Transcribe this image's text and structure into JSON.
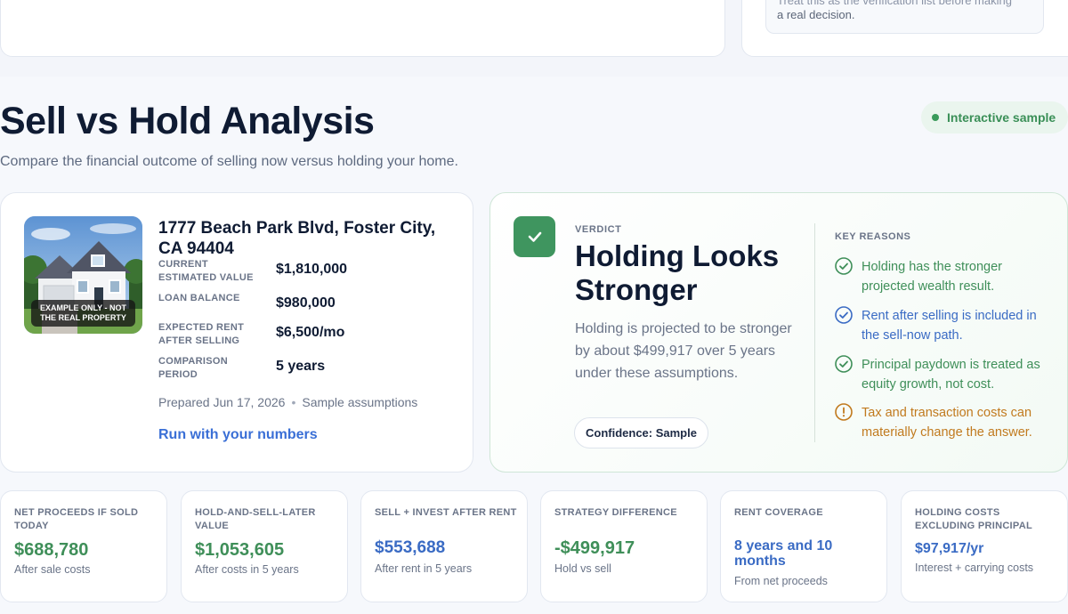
{
  "top_note": {
    "line1": "Treat this as the verification list before making",
    "line2": "a real decision."
  },
  "header": {
    "title": "Sell vs Hold Analysis",
    "subtitle": "Compare the financial outcome of selling now versus holding your home.",
    "badge": "Interactive sample"
  },
  "property": {
    "photo_caption": "EXAMPLE ONLY - NOT THE REAL PROPERTY",
    "address": "1777 Beach Park Blvd, Foster City, CA 94404",
    "rows": [
      {
        "label": "CURRENT ESTIMATED VALUE",
        "value": "$1,810,000"
      },
      {
        "label": "LOAN BALANCE",
        "value": "$980,000"
      },
      {
        "label": "EXPECTED RENT AFTER SELLING",
        "value": "$6,500/mo"
      },
      {
        "label": "COMPARISON PERIOD",
        "value": "5 years"
      }
    ],
    "prepared": "Prepared Jun 17, 2026",
    "assumptions": "Sample assumptions",
    "run_link": "Run with your numbers"
  },
  "verdict": {
    "label": "VERDICT",
    "title": "Holding Looks Stronger",
    "text": "Holding is projected to be stronger by about $499,917 over 5 years under these assumptions.",
    "confidence": "Confidence: Sample",
    "reasons_label": "KEY REASONS",
    "reasons": [
      {
        "text": "Holding has the stronger projected wealth result.",
        "tone": "green",
        "icon": "check-circle-icon"
      },
      {
        "text": "Rent after selling is included in the sell-now path.",
        "tone": "blue",
        "icon": "check-circle-icon"
      },
      {
        "text": "Principal paydown is treated as equity growth, not cost.",
        "tone": "green",
        "icon": "check-circle-icon"
      },
      {
        "text": "Tax and transaction costs can materially change the answer.",
        "tone": "amber",
        "icon": "alert-circle-icon"
      }
    ]
  },
  "stats": [
    {
      "label": "NET PROCEEDS IF SOLD TODAY",
      "value": "$688,780",
      "sub": "After sale costs",
      "tone": "green"
    },
    {
      "label": "HOLD-AND-SELL-LATER VALUE",
      "value": "$1,053,605",
      "sub": "After costs in 5 years",
      "tone": "green"
    },
    {
      "label": "SELL + INVEST AFTER RENT",
      "value": "$553,688",
      "sub": "After rent in 5 years",
      "tone": "blue"
    },
    {
      "label": "STRATEGY DIFFERENCE",
      "value": "-$499,917",
      "sub": "Hold vs sell",
      "tone": "green"
    },
    {
      "label": "RENT COVERAGE",
      "value": "8 years and 10 months",
      "sub": "From net proceeds",
      "tone": "blue"
    },
    {
      "label": "HOLDING COSTS EXCLUDING PRINCIPAL",
      "value": "$97,917/yr",
      "sub": "Interest + carrying costs",
      "tone": "blue"
    }
  ],
  "colors": {
    "green": "#3f8f59",
    "blue": "#3a6bc4",
    "amber": "#c17a1e",
    "navy": "#0f1b33"
  }
}
